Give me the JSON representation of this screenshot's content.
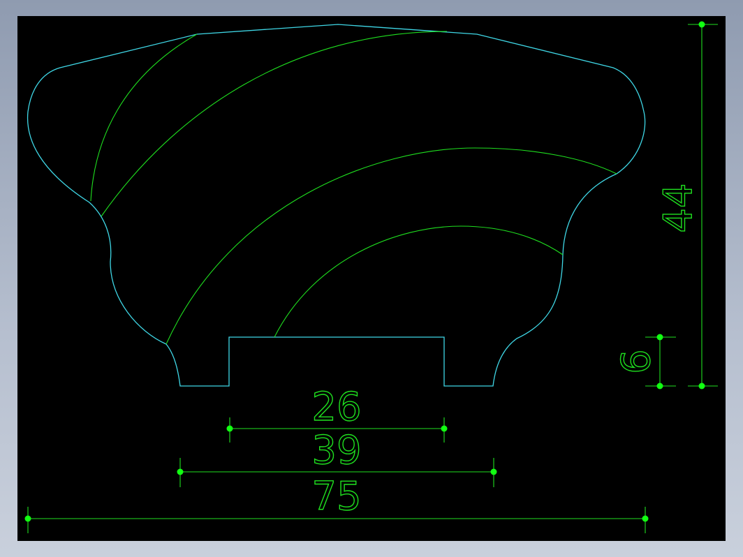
{
  "colors": {
    "background": "#000000",
    "profile": "#3fd7e6",
    "construction": "#1fe01f",
    "dimension": "#1fe01f",
    "grip": "#12ff12"
  },
  "dimensions": {
    "slot_width": "26",
    "base_width": "39",
    "overall_width": "75",
    "overall_height": "44",
    "slot_depth": "6"
  }
}
